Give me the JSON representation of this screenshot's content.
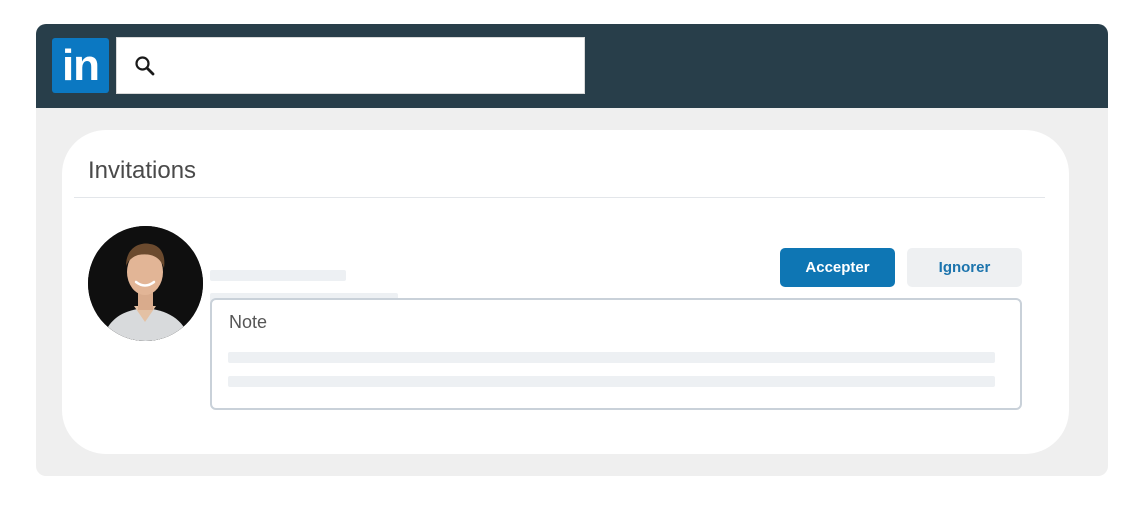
{
  "header": {
    "logo_text": "in",
    "search": {
      "value": "",
      "placeholder": ""
    },
    "colors": {
      "bar": "#283e4a",
      "logo": "#0b78c2"
    }
  },
  "invitations": {
    "title": "Invitations",
    "invite": {
      "avatar": "profile-photo",
      "accept_label": "Accepter",
      "ignore_label": "Ignorer",
      "note_label": "Note"
    },
    "colors": {
      "accept": "#0e76b4",
      "ignore_text": "#1c74ad"
    }
  }
}
